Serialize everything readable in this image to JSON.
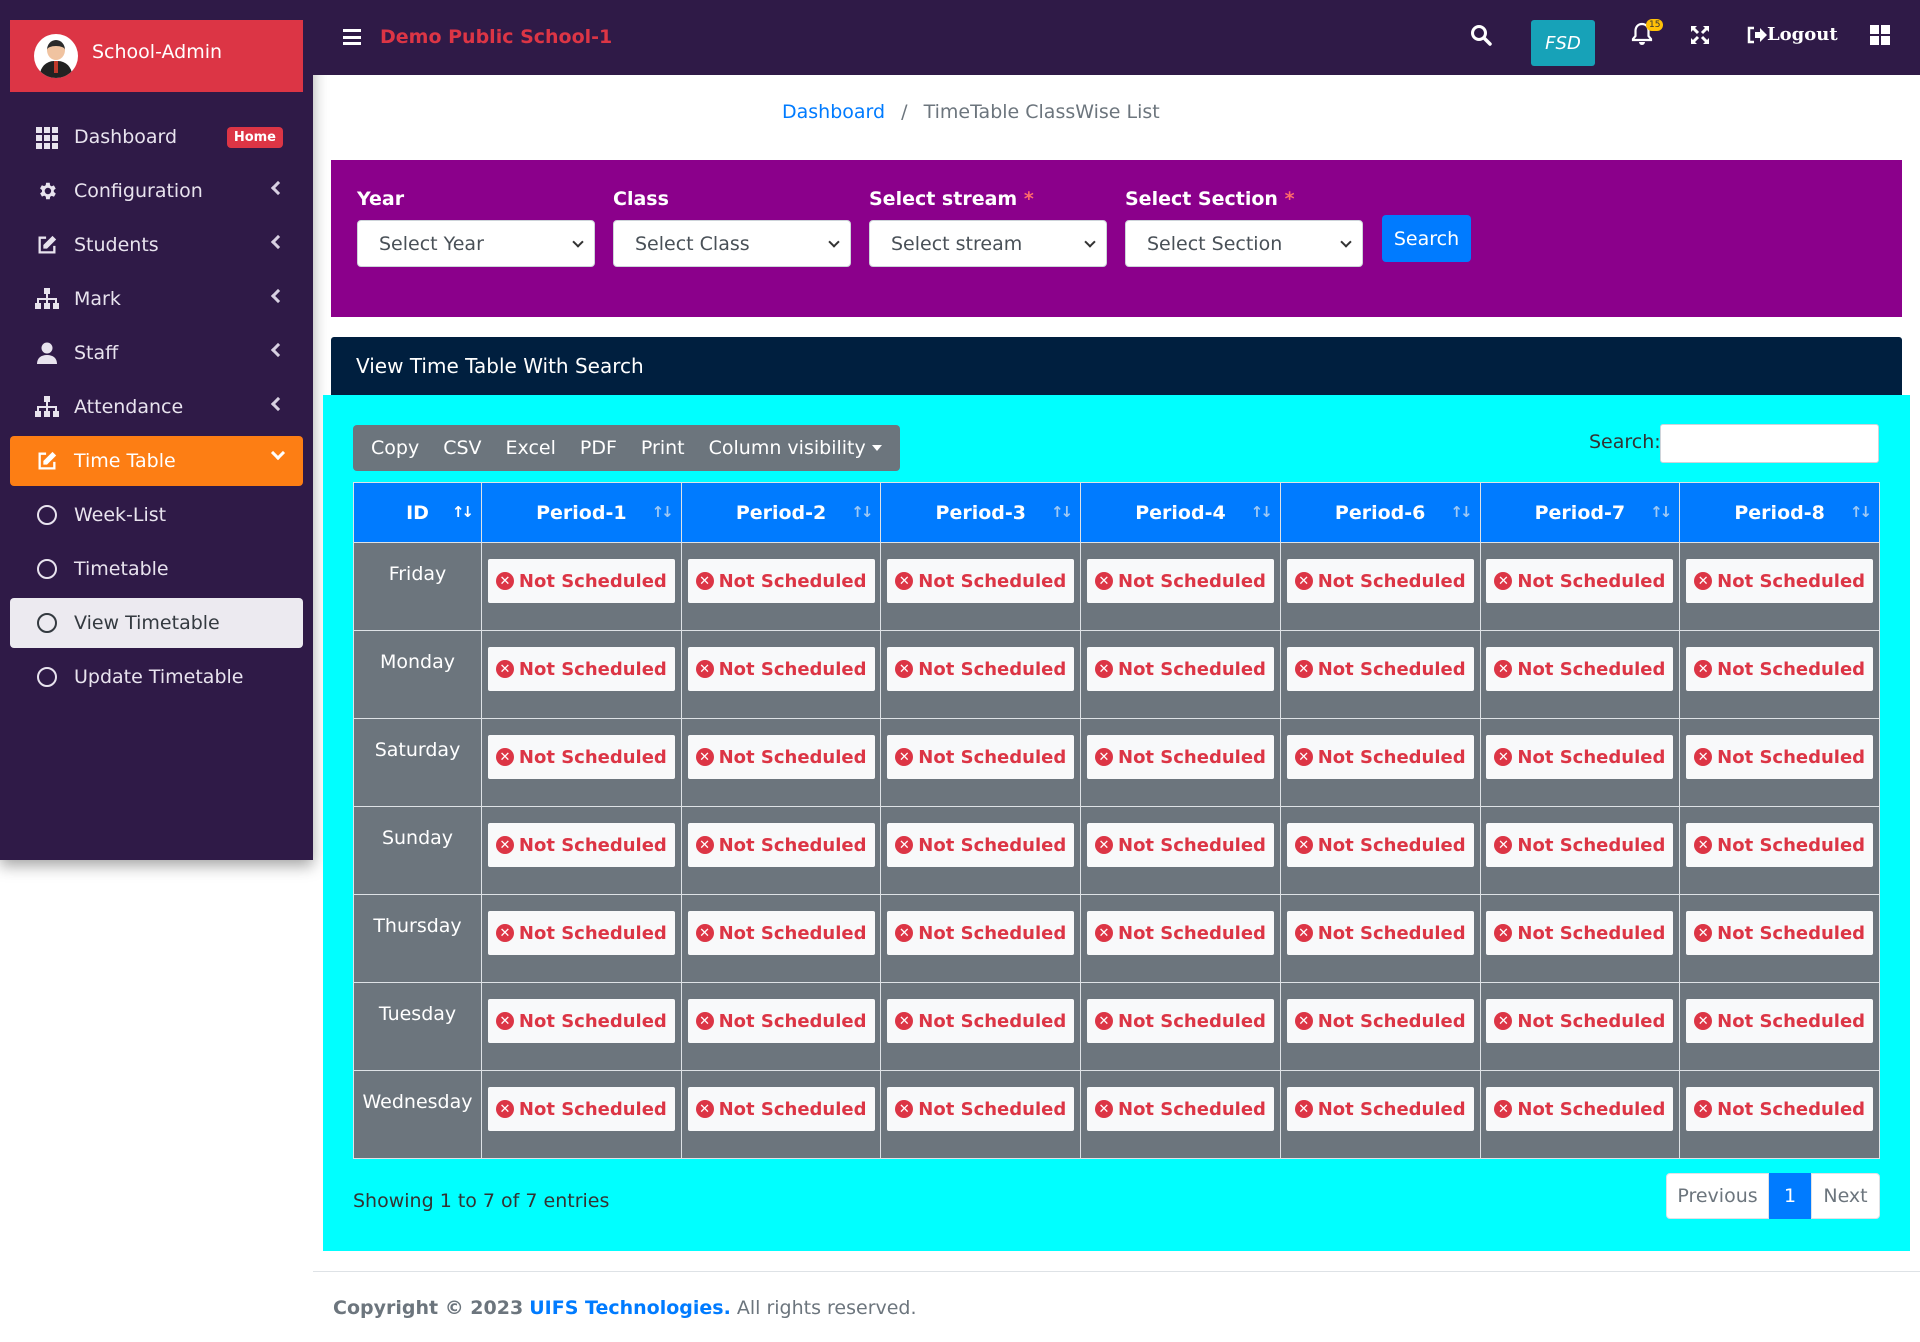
{
  "sidebar": {
    "brand": "School-Admin",
    "items": [
      {
        "label": "Dashboard",
        "badge": "Home",
        "icon": "th-grid-icon"
      },
      {
        "label": "Configuration",
        "icon": "gear-icon"
      },
      {
        "label": "Students",
        "icon": "edit-icon"
      },
      {
        "label": "Mark",
        "icon": "sitemap-icon"
      },
      {
        "label": "Staff",
        "icon": "user-icon"
      },
      {
        "label": "Attendance",
        "icon": "sitemap-icon"
      },
      {
        "label": "Time Table",
        "icon": "edit-icon"
      }
    ],
    "subitems": [
      {
        "label": "Week-List"
      },
      {
        "label": "Timetable"
      },
      {
        "label": "View Timetable"
      },
      {
        "label": "Update Timetable"
      }
    ]
  },
  "topbar": {
    "school_name": "Demo Public School-1",
    "fsd_label": "FSD",
    "notification_count": "15",
    "logout_label": "Logout"
  },
  "breadcrumb": {
    "home": "Dashboard",
    "separator": "/",
    "current": "TimeTable ClassWise List"
  },
  "filters": {
    "year": {
      "label": "Year",
      "value": "Select Year"
    },
    "class": {
      "label": "Class",
      "value": "Select Class"
    },
    "stream": {
      "label": "Select stream",
      "required": "*",
      "value": "Select stream"
    },
    "section": {
      "label": "Select Section",
      "required": "*",
      "value": "Select Section"
    },
    "search_button": "Search"
  },
  "view": {
    "title": "View Time Table With Search",
    "buttons": [
      "Copy",
      "CSV",
      "Excel",
      "PDF",
      "Print",
      "Column visibility"
    ],
    "search_label": "Search:",
    "columns": [
      "ID",
      "Period-1",
      "Period-2",
      "Period-3",
      "Period-4",
      "Period-6",
      "Period-7",
      "Period-8"
    ],
    "rows": [
      {
        "day": "Friday",
        "cells": [
          "Not Scheduled",
          "Not Scheduled",
          "Not Scheduled",
          "Not Scheduled",
          "Not Scheduled",
          "Not Scheduled",
          "Not Scheduled"
        ]
      },
      {
        "day": "Monday",
        "cells": [
          "Not Scheduled",
          "Not Scheduled",
          "Not Scheduled",
          "Not Scheduled",
          "Not Scheduled",
          "Not Scheduled",
          "Not Scheduled"
        ]
      },
      {
        "day": "Saturday",
        "cells": [
          "Not Scheduled",
          "Not Scheduled",
          "Not Scheduled",
          "Not Scheduled",
          "Not Scheduled",
          "Not Scheduled",
          "Not Scheduled"
        ]
      },
      {
        "day": "Sunday",
        "cells": [
          "Not Scheduled",
          "Not Scheduled",
          "Not Scheduled",
          "Not Scheduled",
          "Not Scheduled",
          "Not Scheduled",
          "Not Scheduled"
        ]
      },
      {
        "day": "Thursday",
        "cells": [
          "Not Scheduled",
          "Not Scheduled",
          "Not Scheduled",
          "Not Scheduled",
          "Not Scheduled",
          "Not Scheduled",
          "Not Scheduled"
        ]
      },
      {
        "day": "Tuesday",
        "cells": [
          "Not Scheduled",
          "Not Scheduled",
          "Not Scheduled",
          "Not Scheduled",
          "Not Scheduled",
          "Not Scheduled",
          "Not Scheduled"
        ]
      },
      {
        "day": "Wednesday",
        "cells": [
          "Not Scheduled",
          "Not Scheduled",
          "Not Scheduled",
          "Not Scheduled",
          "Not Scheduled",
          "Not Scheduled",
          "Not Scheduled"
        ]
      }
    ],
    "entries_info": "Showing 1 to 7 of 7 entries",
    "pagination": {
      "previous": "Previous",
      "current": "1",
      "next": "Next"
    }
  },
  "footer": {
    "copyright": "Copyright © 2023",
    "company": "UIFS Technologies.",
    "rights": "All rights reserved."
  },
  "colors": {
    "sidebar_bg": "#2f1a47",
    "brand_red": "#dc3545",
    "active_orange": "#fd7e14",
    "filter_purple": "#8b008b",
    "view_header_navy": "#001f3f",
    "view_body_cyan": "#00ffff",
    "primary_blue": "#007bff",
    "cell_gray": "#6c757d"
  }
}
